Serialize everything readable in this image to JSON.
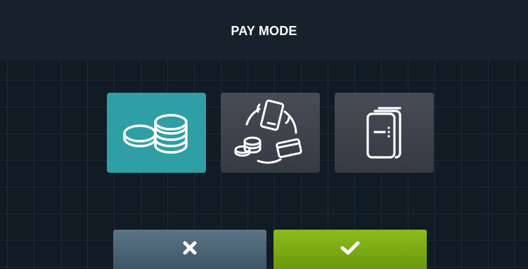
{
  "header": {
    "title": "PAY MODE"
  },
  "pay_modes": [
    {
      "id": "coins",
      "icon": "coins-icon",
      "selected": true
    },
    {
      "id": "cashless",
      "icon": "cashless-payment-icon",
      "selected": false
    },
    {
      "id": "token",
      "icon": "token-machine-icon",
      "selected": false
    }
  ],
  "actions": {
    "cancel_icon": "close-icon",
    "confirm_icon": "checkmark-icon"
  },
  "colors": {
    "selected_tile": "#2f9ea5",
    "unselected_tile": "#3d424c",
    "cancel_button": "#4a6374",
    "confirm_button": "#7aaa14",
    "background": "#111b24"
  }
}
